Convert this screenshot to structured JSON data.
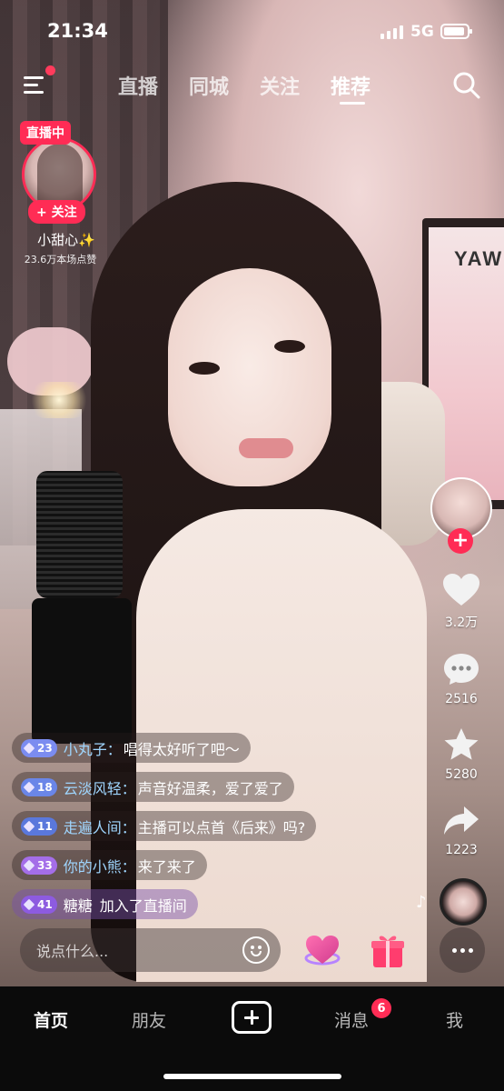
{
  "status_bar": {
    "time": "21:34",
    "network": "5G"
  },
  "top_nav": {
    "tabs": [
      {
        "label": "直播"
      },
      {
        "label": "同城"
      },
      {
        "label": "关注"
      },
      {
        "label": "推荐"
      }
    ],
    "active_tab": "推荐"
  },
  "live_host": {
    "badge": "直播中",
    "follow_label": "+ 关注",
    "name": "小甜心✨",
    "likes": "23.6万本场点赞"
  },
  "poster": {
    "text": "YAW"
  },
  "right_rail": {
    "follow_plus": "+",
    "likes": "3.2万",
    "comments": "2516",
    "favorites": "5280",
    "shares": "1223"
  },
  "chat": {
    "messages": [
      {
        "level": "23",
        "name": "小丸子：",
        "text": "唱得太好听了吧～",
        "level_color": "#7b8cf0"
      },
      {
        "level": "18",
        "name": "云淡风轻：",
        "text": "声音好温柔，爱了爱了",
        "level_color": "#6a86e8"
      },
      {
        "level": "11",
        "name": "走遍人间：",
        "text": "主播可以点首《后来》吗?",
        "level_color": "#5a78dc"
      },
      {
        "level": "33",
        "name": "你的小熊：",
        "text": "来了来了",
        "level_color": "#a46ee8"
      }
    ],
    "join": {
      "level": "41",
      "name": "糖糖",
      "text": "加入了直播间",
      "level_color": "#8d5be0"
    }
  },
  "input": {
    "placeholder": "说点什么..."
  },
  "bottom_nav": {
    "home": "首页",
    "friends": "朋友",
    "messages": "消息",
    "messages_badge": "6",
    "me": "我"
  },
  "colors": {
    "accent": "#ff2c55",
    "username": "#9fd6ff"
  }
}
